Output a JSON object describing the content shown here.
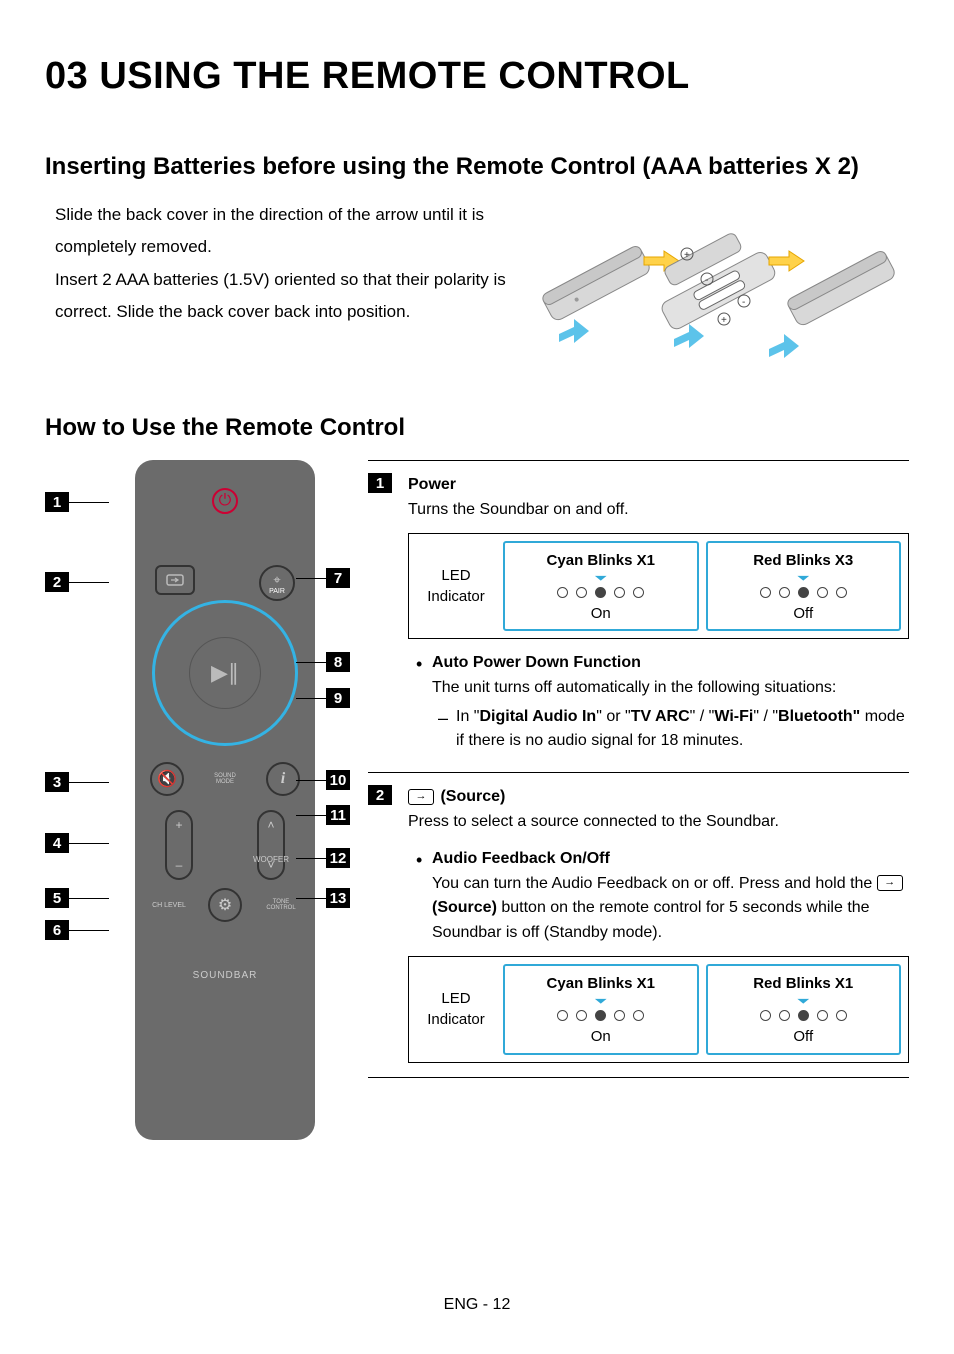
{
  "header": {
    "title": "03 USING THE REMOTE CONTROL"
  },
  "section_batteries": {
    "heading": "Inserting Batteries before using the Remote Control (AAA batteries X 2)",
    "para1": "Slide the back cover in the direction of the arrow until it is completely removed.",
    "para2": "Insert 2 AAA batteries (1.5V) oriented so that their polarity is correct. Slide the back cover back into position."
  },
  "section_usage": {
    "heading": "How to Use the Remote Control"
  },
  "remote_labels": {
    "pair": "PAIR",
    "sound_mode": "SOUND\nMODE",
    "woofer": "WOOFER",
    "ch_level": "CH LEVEL",
    "tone_control": "TONE\nCONTROL",
    "brand": "SOUNDBAR"
  },
  "callouts": {
    "c1": "1",
    "c2": "2",
    "c3": "3",
    "c4": "4",
    "c5": "5",
    "c6": "6",
    "c7": "7",
    "c8": "8",
    "c9": "9",
    "c10": "10",
    "c11": "11",
    "c12": "12",
    "c13": "13"
  },
  "desc": {
    "item1": {
      "num": "1",
      "title": "Power",
      "text": "Turns the Soundbar on and off.",
      "led_label1": "LED",
      "led_label2": "Indicator",
      "panel1_hdr": "Cyan Blinks X1",
      "panel1_sub": "On",
      "panel2_hdr": "Red Blinks X3",
      "panel2_sub": "Off",
      "apd_title": "Auto Power Down Function",
      "apd_line": "The unit turns off automatically in the following situations:",
      "apd_sub_pre": "In \"",
      "apd_b1": "Digital Audio In",
      "apd_mid1": "\" or \"",
      "apd_b2": "TV ARC",
      "apd_mid2": "\" / \"",
      "apd_b3": "Wi-Fi",
      "apd_mid3": "\" / \"",
      "apd_b4": "Bluetooth\"",
      "apd_tail": " mode if there is no audio signal for 18 minutes."
    },
    "item2": {
      "num": "2",
      "title": " (Source)",
      "text": "Press to select a source connected to the Soundbar.",
      "af_title": "Audio Feedback On/Off",
      "af_l1": "You can turn the Audio Feedback on or off. Press and hold the ",
      "af_b": " (Source)",
      "af_l2": " button on the remote control for 5 seconds while the Soundbar is off (Standby mode).",
      "led_label1": "LED",
      "led_label2": "Indicator",
      "panel1_hdr": "Cyan Blinks X1",
      "panel1_sub": "On",
      "panel2_hdr": "Red Blinks X1",
      "panel2_sub": "Off"
    }
  },
  "footer": {
    "page": "ENG - 12"
  }
}
